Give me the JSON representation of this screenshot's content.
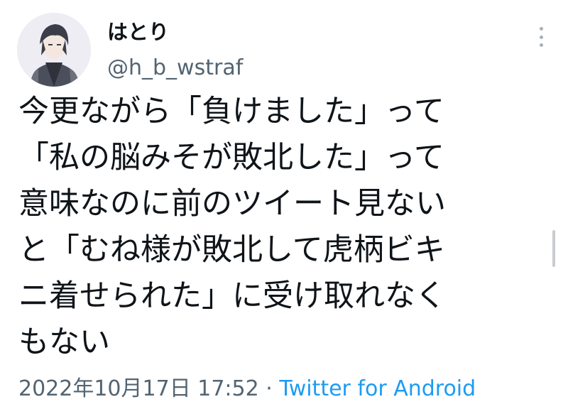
{
  "user": {
    "display_name": "はとり",
    "handle": "@h_b_wstraf"
  },
  "menu": {
    "icon": "more-vertical-icon"
  },
  "tweet": {
    "lines": [
      "今更ながら「負けました」って",
      "「私の脳みそが敗北した」って",
      "意味なのに前のツイート見ない",
      "と「むね様が敗北して虎柄ビキ",
      "ニ着せられた」に受け取れなく",
      "もない"
    ]
  },
  "meta": {
    "timestamp": "2022年10月17日 17:52",
    "separator": "·",
    "source": "Twitter for Android"
  },
  "colors": {
    "text": "#0f1419",
    "secondary": "#536471",
    "link": "#1d9bf0"
  }
}
